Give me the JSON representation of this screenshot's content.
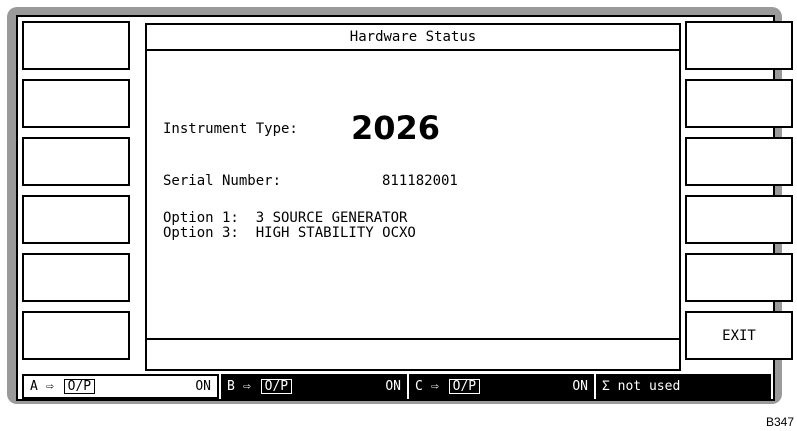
{
  "title": "Hardware Status",
  "instrument": {
    "type_label": "Instrument Type:",
    "type_value": "2026",
    "serial_label": "Serial Number:",
    "serial_value": "811182001"
  },
  "options": [
    {
      "label": "Option 1:",
      "value": "3 SOURCE GENERATOR"
    },
    {
      "label": "Option 3:",
      "value": "HIGH STABILITY OCXO"
    }
  ],
  "softkeys": {
    "left": [
      "",
      "",
      "",
      "",
      "",
      ""
    ],
    "right": [
      "",
      "",
      "",
      "",
      "",
      "EXIT"
    ]
  },
  "status_bar": [
    {
      "source": "A",
      "arrow": "⇨",
      "output": "O/P",
      "state": "ON",
      "style": "white"
    },
    {
      "source": "B",
      "arrow": "⇨",
      "output": "O/P",
      "state": "ON",
      "style": "black"
    },
    {
      "source": "C",
      "arrow": "⇨",
      "output": "O/P",
      "state": "ON",
      "style": "black"
    },
    {
      "text": "Σ not used",
      "style": "black"
    }
  ],
  "figure_ref": "B347"
}
